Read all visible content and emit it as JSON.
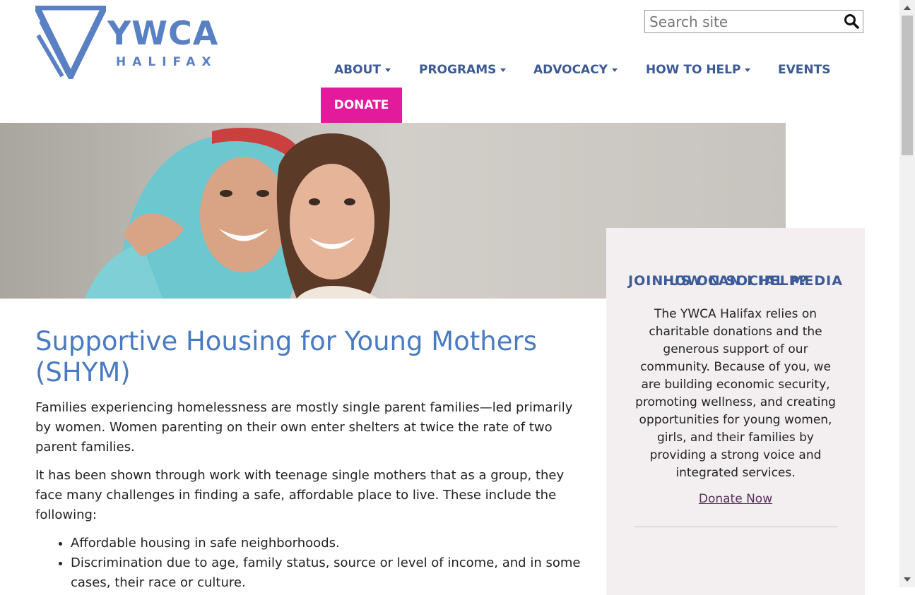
{
  "logo": {
    "name": "YWCA",
    "subname": "HALIFAX"
  },
  "search": {
    "placeholder": "Search site",
    "value": ""
  },
  "nav": {
    "items": [
      {
        "label": "ABOUT",
        "dropdown": true
      },
      {
        "label": "PROGRAMS",
        "dropdown": true
      },
      {
        "label": "ADVOCACY",
        "dropdown": true
      },
      {
        "label": "HOW TO HELP",
        "dropdown": true
      },
      {
        "label": "EVENTS",
        "dropdown": false
      }
    ],
    "donate": "DONATE"
  },
  "colors": {
    "brand_blue": "#3c5a96",
    "logo_blue": "#5a80c4",
    "donate_pink": "#e11b9b",
    "heading_blue": "#4a7ac0",
    "sidebar_bg": "#f3eff0"
  },
  "hero": {
    "icon": "hero-photo-two-women-smiling"
  },
  "sidebar": {
    "heading": "HOW CAN I HELP?",
    "text": "The YWCA Halifax relies on charitable donations and the generous support of our community. Because of you, we are building economic security, promoting wellness, and creating opportunities for young women, girls, and their families by providing a strong voice and integrated services.",
    "link": "Donate Now",
    "social_heading": "JOIN US ON SOCIAL MEDIA"
  },
  "main": {
    "title": "Supportive Housing for Young Mothers (SHYM)",
    "paragraphs": [
      "Families experiencing homelessness are mostly single parent families—led primarily by women. Women parenting on their own enter shelters at twice the rate of two parent families.",
      "It has been shown through work with teenage single mothers that as a group,  they face many challenges in finding a safe, affordable place to live. These include the following:"
    ],
    "list": [
      "Affordable housing in safe neighborhoods.",
      "Discrimination due to age, family status, source or level of income, and in some cases, their race or culture."
    ]
  }
}
